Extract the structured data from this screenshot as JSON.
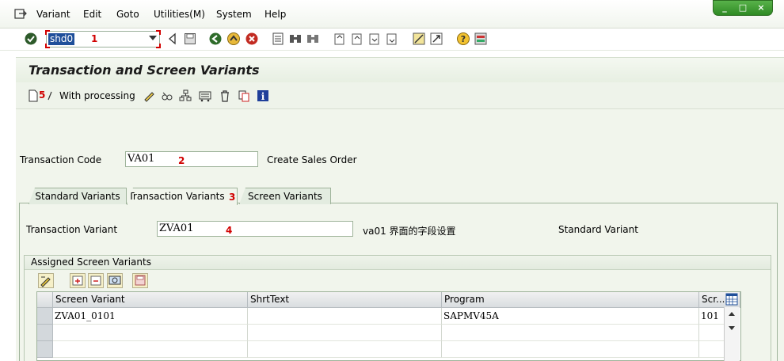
{
  "menu": {
    "items": [
      "Variant",
      "Edit",
      "Goto",
      "Utilities(M)",
      "System",
      "Help"
    ]
  },
  "window_controls": [
    "_",
    "□",
    "×"
  ],
  "toolbar": {
    "command_value": "shd0"
  },
  "annotations": [
    "1",
    "2",
    "3",
    "4",
    "5"
  ],
  "title": "Transaction and Screen Variants",
  "app_toolbar": {
    "with_processing_label": "With processing"
  },
  "form": {
    "transaction_code_label": "Transaction Code",
    "transaction_code_value": "VA01",
    "transaction_code_desc": "Create Sales Order"
  },
  "tabs": [
    "Standard Variants",
    "Transaction Variants",
    "Screen Variants"
  ],
  "active_tab": "Transaction Variants",
  "variant": {
    "label": "Transaction Variant",
    "value": "ZVA01",
    "desc": "va01 界面的字段设置",
    "standard_label": "Standard Variant"
  },
  "assigned": {
    "title": "Assigned Screen Variants",
    "columns": [
      "Screen Variant",
      "ShrtText",
      "Program",
      "Scr..."
    ],
    "rows": [
      [
        "ZVA01_0101",
        "",
        "SAPMV45A",
        "101"
      ],
      [
        "",
        "",
        "",
        ""
      ],
      [
        "",
        "",
        "",
        ""
      ]
    ]
  }
}
